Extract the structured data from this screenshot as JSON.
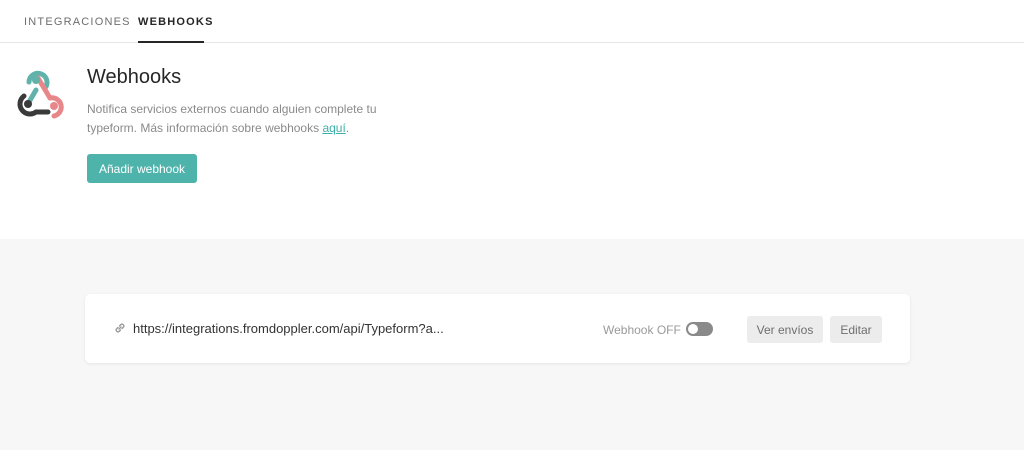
{
  "tabs": [
    {
      "label": "INTEGRACIONES",
      "active": false
    },
    {
      "label": "WEBHOOKS",
      "active": true
    }
  ],
  "header": {
    "title": "Webhooks",
    "description": "Notifica servicios externos cuando alguien complete tu typeform. Más información sobre webhooks ",
    "link_text": "aquí",
    "after_link": ".",
    "add_button": "Añadir webhook",
    "logo_icon": "webhook-logo-icon"
  },
  "webhook": {
    "url": "https://integrations.fromdoppler.com/api/Typeform?a...",
    "toggle_label": "Webhook OFF",
    "enabled": false,
    "view_button": "Ver envíos",
    "edit_button": "Editar",
    "link_icon": "link-icon"
  },
  "colors": {
    "accent": "#4db3ab",
    "logo_dark": "#3a3a3a",
    "logo_teal": "#5fb3aa",
    "logo_pink": "#e8878a"
  }
}
